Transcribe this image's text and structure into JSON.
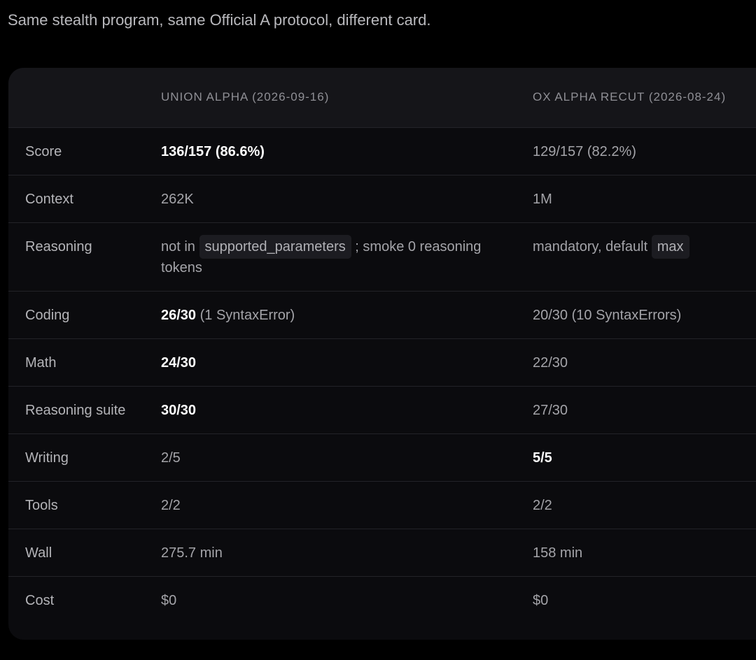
{
  "intro": "Same stealth program, same Official A protocol, different card.",
  "table": {
    "headers": [
      "",
      "UNION ALPHA (2026-09-16)",
      "OX ALPHA RECUT (2026-08-24)"
    ],
    "rows": [
      {
        "label": "Score",
        "c1_strong": "136/157 (86.6%)",
        "c2": "129/157 (82.2%)"
      },
      {
        "label": "Context",
        "c1": "262K",
        "c2": "1M"
      },
      {
        "label": "Reasoning",
        "c1_pre": "not in",
        "c1_code": "supported_parameters",
        "c1_post": "; smoke 0 reasoning tokens",
        "c2_pre": "mandatory, default",
        "c2_code": "max"
      },
      {
        "label": "Coding",
        "c1_strong": "26/30",
        "c1_rest": " (1 SyntaxError)",
        "c2": "20/30 (10 SyntaxErrors)"
      },
      {
        "label": "Math",
        "c1_strong": "24/30",
        "c2": "22/30"
      },
      {
        "label": "Reasoning suite",
        "c1_strong": "30/30",
        "c2": "27/30"
      },
      {
        "label": "Writing",
        "c1": "2/5",
        "c2_strong": "5/5"
      },
      {
        "label": "Tools",
        "c1": "2/2",
        "c2": "2/2"
      },
      {
        "label": "Wall",
        "c1": "275.7 min",
        "c2": "158 min"
      },
      {
        "label": "Cost",
        "c1": "$0",
        "c2": "$0"
      }
    ]
  }
}
